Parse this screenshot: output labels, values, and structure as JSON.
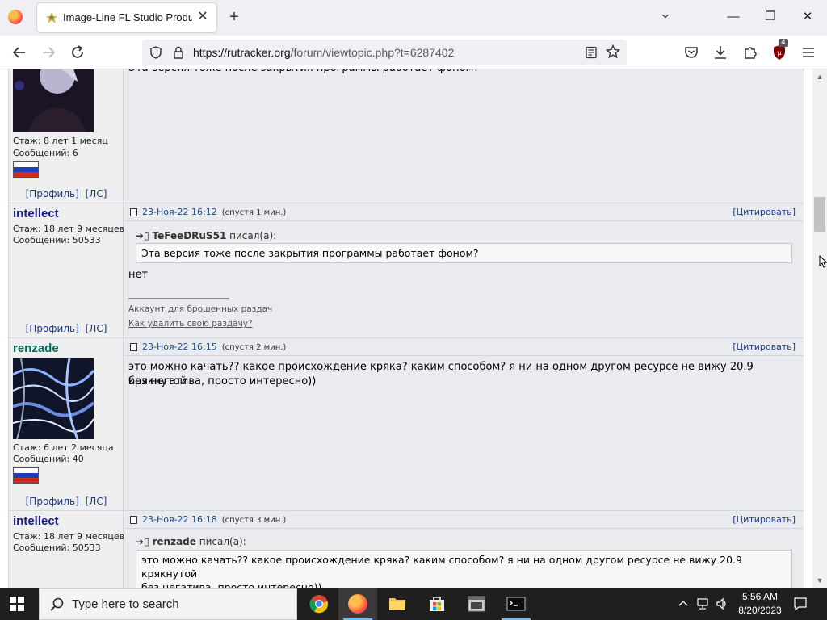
{
  "browser": {
    "tab_title": "Image-Line FL Studio Producer",
    "tab_close": "✕",
    "new_tab": "+",
    "url_host": "https://rutracker.org",
    "url_path": "/forum/viewtopic.php?t=6287402",
    "extension_badge": "4",
    "window_controls": {
      "minimize": "—",
      "maximize": "❐",
      "close": "✕"
    }
  },
  "posts": [
    {
      "stazh": "Стаж: 8 лет 1 месяц",
      "messages": "Сообщений: 6",
      "text": "Эта версия тоже после закрытия программы работает фоном?",
      "profile": "[Профиль]",
      "pm": "[ЛС]"
    },
    {
      "nick": "intellect",
      "date": "23-Ноя-22 16:12",
      "after": "(спустя 1 мин.)",
      "quote_btn": "[Цитировать]",
      "stazh": "Стаж: 18 лет 9 месяцев",
      "messages": "Сообщений: 50533",
      "quote_author": "TeFeeDRuS51",
      "quote_wrote": "писал(а):",
      "quote_text": "Эта версия тоже после закрытия программы работает фоном?",
      "text": "нет",
      "sig1": "Аккаунт для брошенных раздач",
      "sig2": "Как удалить свою раздачу?",
      "profile": "[Профиль]",
      "pm": "[ЛС]"
    },
    {
      "nick": "renzade",
      "date": "23-Ноя-22 16:15",
      "after": "(спустя 2 мин.)",
      "quote_btn": "[Цитировать]",
      "stazh": "Стаж: 6 лет 2 месяца",
      "messages": "Сообщений: 40",
      "text_line1": "это можно качать?? какое происхождение кряка? каким способом? я ни на одном другом ресурсе не вижу 20.9 крякнутой",
      "text_line2": "без негатива, просто интересно))",
      "profile": "[Профиль]",
      "pm": "[ЛС]"
    },
    {
      "nick": "intellect",
      "date": "23-Ноя-22 16:18",
      "after": "(спустя 3 мин.)",
      "quote_btn": "[Цитировать]",
      "stazh": "Стаж: 18 лет 9 месяцев",
      "messages": "Сообщений: 50533",
      "quote_author": "renzade",
      "quote_wrote": "писал(а):",
      "quote_line1": "это можно качать?? какое происхождение кряка? каким способом? я ни на одном другом ресурсе не вижу 20.9",
      "quote_line2": "крякнутой",
      "quote_line3": "без негатива, просто интересно))"
    }
  ],
  "taskbar": {
    "search_placeholder": "Type here to search",
    "time": "5:56 AM",
    "date": "8/20/2023"
  }
}
